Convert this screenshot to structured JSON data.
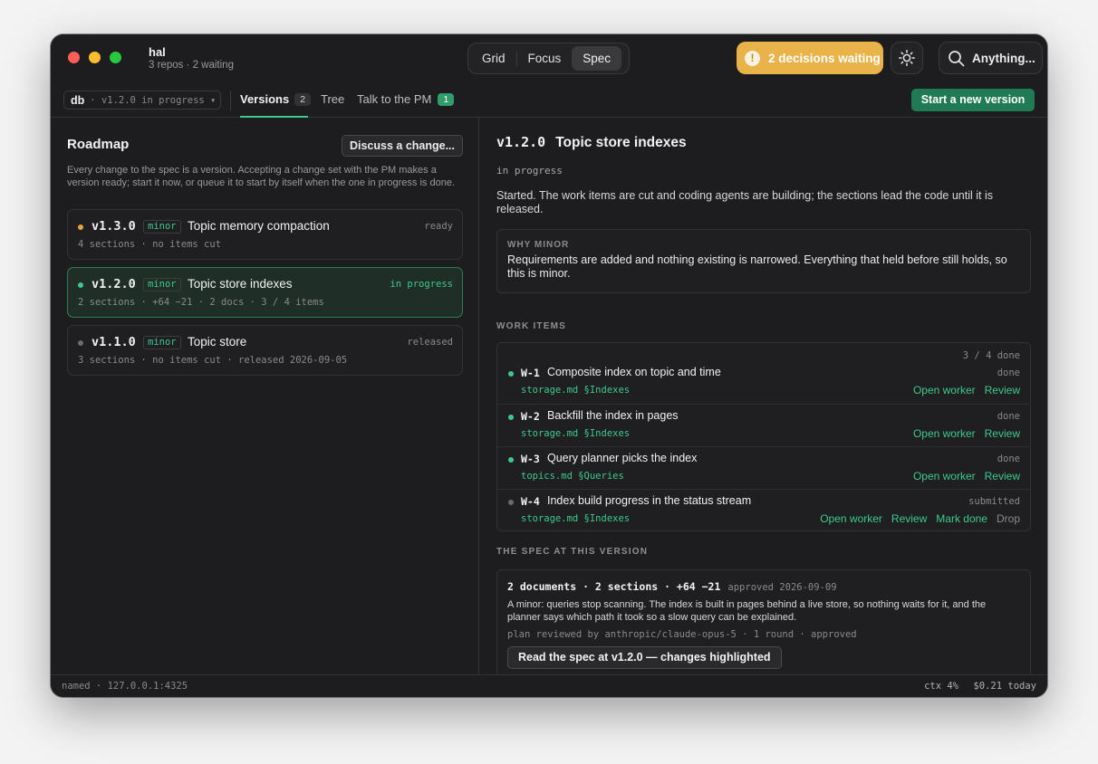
{
  "window": {
    "app_name": "hal",
    "subtitle": "3 repos · 2 waiting"
  },
  "view_modes": [
    "Grid",
    "Focus",
    "Spec"
  ],
  "active_view": "Spec",
  "decisions": {
    "label": "2 decisions waiting",
    "icon": "exclamation-icon",
    "color": "#e9b34a"
  },
  "search": {
    "label": "Anything...",
    "icon": "search-icon"
  },
  "theme_icon": "sun-icon",
  "toolbar": {
    "repo": "db",
    "repo_status": "· v1.2.0 in progress ▾",
    "tabs": [
      {
        "label": "Versions",
        "count": "2"
      },
      {
        "label": "Tree"
      },
      {
        "label": "Talk to the PM",
        "count": "1"
      }
    ],
    "new_version_label": "Start a new version"
  },
  "roadmap": {
    "title": "Roadmap",
    "discuss_label": "Discuss a change...",
    "description": "Every change to the spec is a version. Accepting a change set with the PM makes a version ready; start it now, or queue it to start by itself when the one in progress is done.",
    "versions": [
      {
        "version": "v1.3.0",
        "kind": "minor",
        "title": "Topic memory compaction",
        "status": "ready",
        "meta": "4 sections · no items cut",
        "dot_color": "#e9a23b"
      },
      {
        "version": "v1.2.0",
        "kind": "minor",
        "title": "Topic store indexes",
        "status": "in progress",
        "meta": "2 sections · +64 −21 · 2 docs · 3 / 4 items",
        "dot_color": "#3ec98e"
      },
      {
        "version": "v1.1.0",
        "kind": "minor",
        "title": "Topic store",
        "status": "released",
        "meta": "3 sections · no items cut · released 2026-09-05",
        "dot_color": "#6b6b6e"
      }
    ]
  },
  "detail": {
    "version": "v1.2.0",
    "title": "Topic store indexes",
    "status": "in progress",
    "description": "Started. The work items are cut and coding agents are building; the sections lead the code until it is released.",
    "why_label": "WHY MINOR",
    "why_text": "Requirements are added and nothing existing is narrowed. Everything that held before still holds, so this is minor.",
    "work_items_heading": "WORK ITEMS",
    "work_done": "3 / 4 done",
    "work_items": [
      {
        "id": "W-1",
        "title": "Composite index on topic and time",
        "status": "done",
        "ref": "storage.md §Indexes",
        "actions": [
          "Open worker",
          "Review"
        ]
      },
      {
        "id": "W-2",
        "title": "Backfill the index in pages",
        "status": "done",
        "ref": "storage.md §Indexes",
        "actions": [
          "Open worker",
          "Review"
        ]
      },
      {
        "id": "W-3",
        "title": "Query planner picks the index",
        "status": "done",
        "ref": "topics.md §Queries",
        "actions": [
          "Open worker",
          "Review"
        ]
      },
      {
        "id": "W-4",
        "title": "Index build progress in the status stream",
        "status": "submitted",
        "ref": "storage.md §Indexes",
        "actions": [
          "Open worker",
          "Review",
          "Mark done",
          "Drop"
        ]
      }
    ],
    "spec_heading": "THE SPEC AT THIS VERSION",
    "spec_stats": "2 documents · 2 sections · +64 −21",
    "spec_approved": "approved 2026-09-09",
    "spec_description": "A minor: queries stop scanning. The index is built in pages behind a live store, so nothing waits for it, and the planner says which path it took so a slow query can be explained.",
    "spec_review": "plan reviewed by anthropic/claude-opus-5 · 1 round · approved",
    "read_label": "Read the spec at v1.2.0 — changes highlighted"
  },
  "statusbar": {
    "left": "named · 127.0.0.1:4325",
    "ctx": "ctx 4%",
    "cost": "$0.21 today"
  },
  "colors": {
    "accent": "#3ec98e",
    "primary_button": "#1f7a55",
    "warning": "#e9b34a"
  }
}
